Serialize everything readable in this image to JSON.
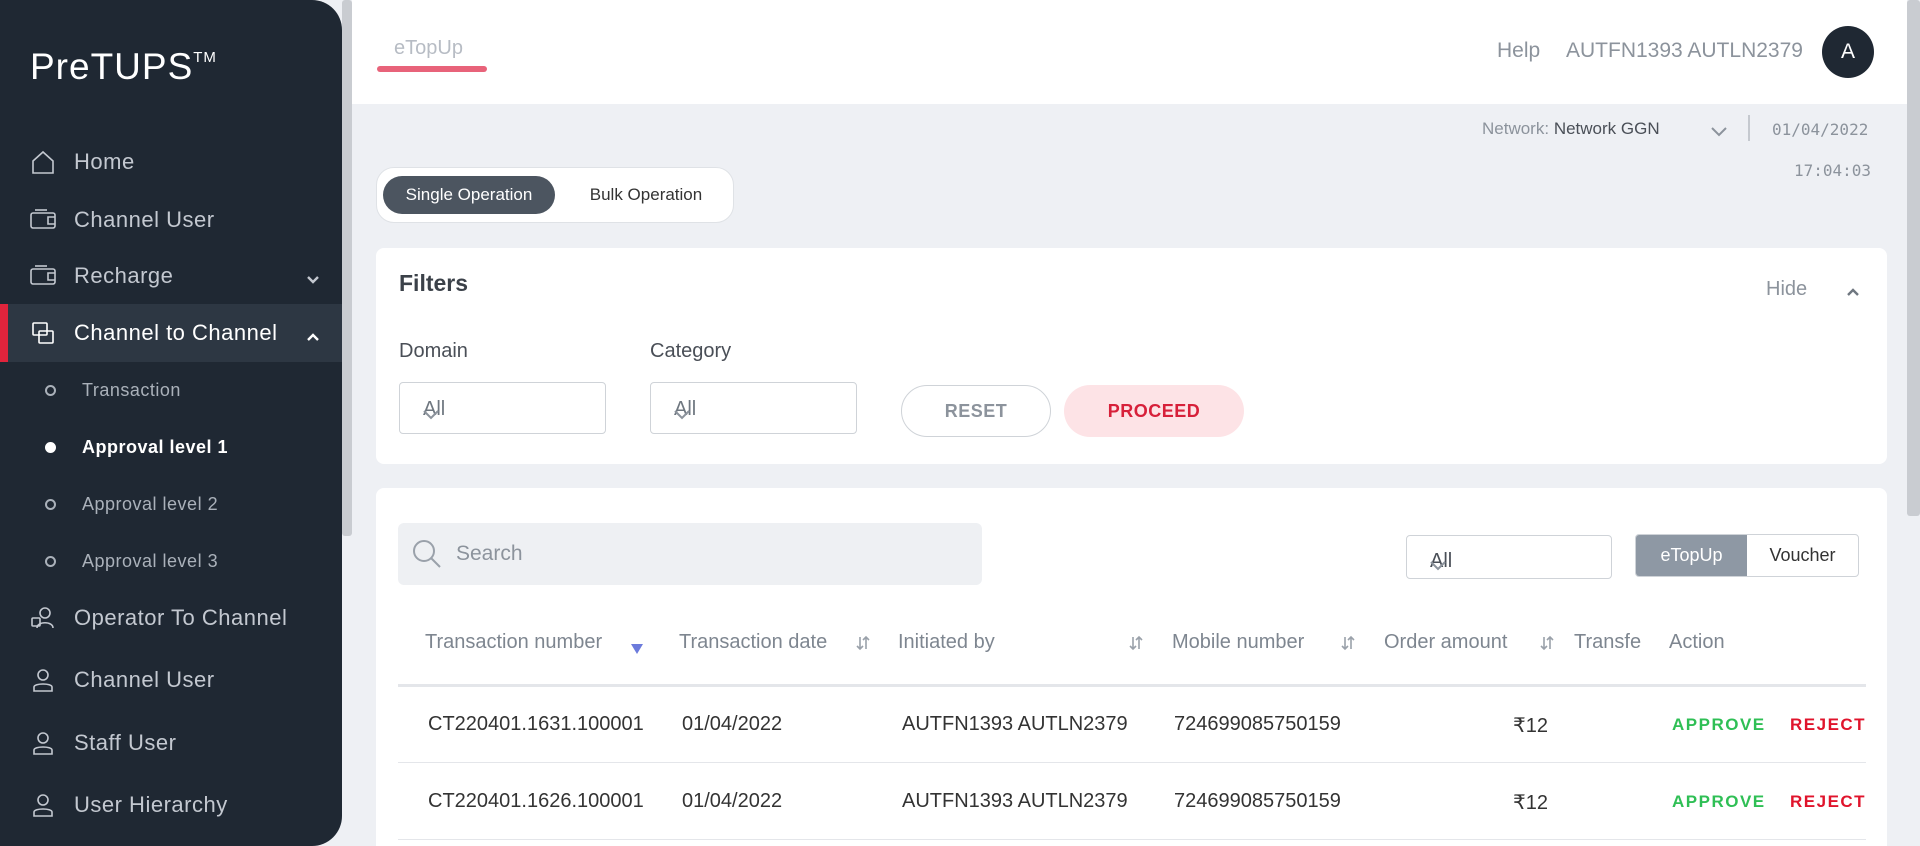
{
  "brand": {
    "name": "PreTUPS",
    "tm": "TM"
  },
  "sidebar": {
    "items": [
      {
        "label": "Home",
        "icon": "home-icon"
      },
      {
        "label": "Channel User",
        "icon": "wallet-icon"
      },
      {
        "label": "Recharge",
        "icon": "wallet-icon",
        "expandable": true
      },
      {
        "label": "Channel to Channel",
        "icon": "transfer-icon",
        "expanded": true,
        "active": true
      },
      {
        "label": "Operator To Channel",
        "icon": "operator-icon"
      },
      {
        "label": "Channel User",
        "icon": "user-icon"
      },
      {
        "label": "Staff User",
        "icon": "user-icon"
      },
      {
        "label": "User Hierarchy",
        "icon": "user-icon"
      }
    ],
    "subitems": [
      {
        "label": "Transaction"
      },
      {
        "label": "Approval level 1",
        "active": true
      },
      {
        "label": "Approval level 2"
      },
      {
        "label": "Approval level 3"
      }
    ]
  },
  "header": {
    "tab": "eTopUp",
    "help": "Help",
    "username": "AUTFN1393 AUTLN2379",
    "avatar_initial": "A",
    "network_label": "Network:",
    "network_value": "Network GGN",
    "date": "01/04/2022",
    "time": "17:04:03"
  },
  "operation": {
    "single": "Single Operation",
    "bulk": "Bulk Operation"
  },
  "filters": {
    "title": "Filters",
    "hide": "Hide",
    "domain_label": "Domain",
    "domain_value": "All",
    "category_label": "Category",
    "category_value": "All",
    "reset": "RESET",
    "proceed": "PROCEED"
  },
  "table": {
    "search_placeholder": "Search",
    "filter_value": "All",
    "type_options": [
      "eTopUp",
      "Voucher"
    ],
    "columns": [
      "Transaction number",
      "Transaction date",
      "Initiated by",
      "Mobile number",
      "Order amount",
      "Transfe",
      "Action"
    ],
    "rows": [
      {
        "txn": "CT220401.1631.100001",
        "date": "01/04/2022",
        "by": "AUTFN1393 AUTLN2379",
        "mobile": "724699085750159",
        "amount": "₹12"
      },
      {
        "txn": "CT220401.1626.100001",
        "date": "01/04/2022",
        "by": "AUTFN1393 AUTLN2379",
        "mobile": "724699085750159",
        "amount": "₹12"
      }
    ],
    "approve": "APPROVE",
    "reject": "REJECT"
  },
  "colors": {
    "sidebar_bg": "#1f2833",
    "accent_red": "#e0243c",
    "approve_green": "#2fbf55"
  }
}
